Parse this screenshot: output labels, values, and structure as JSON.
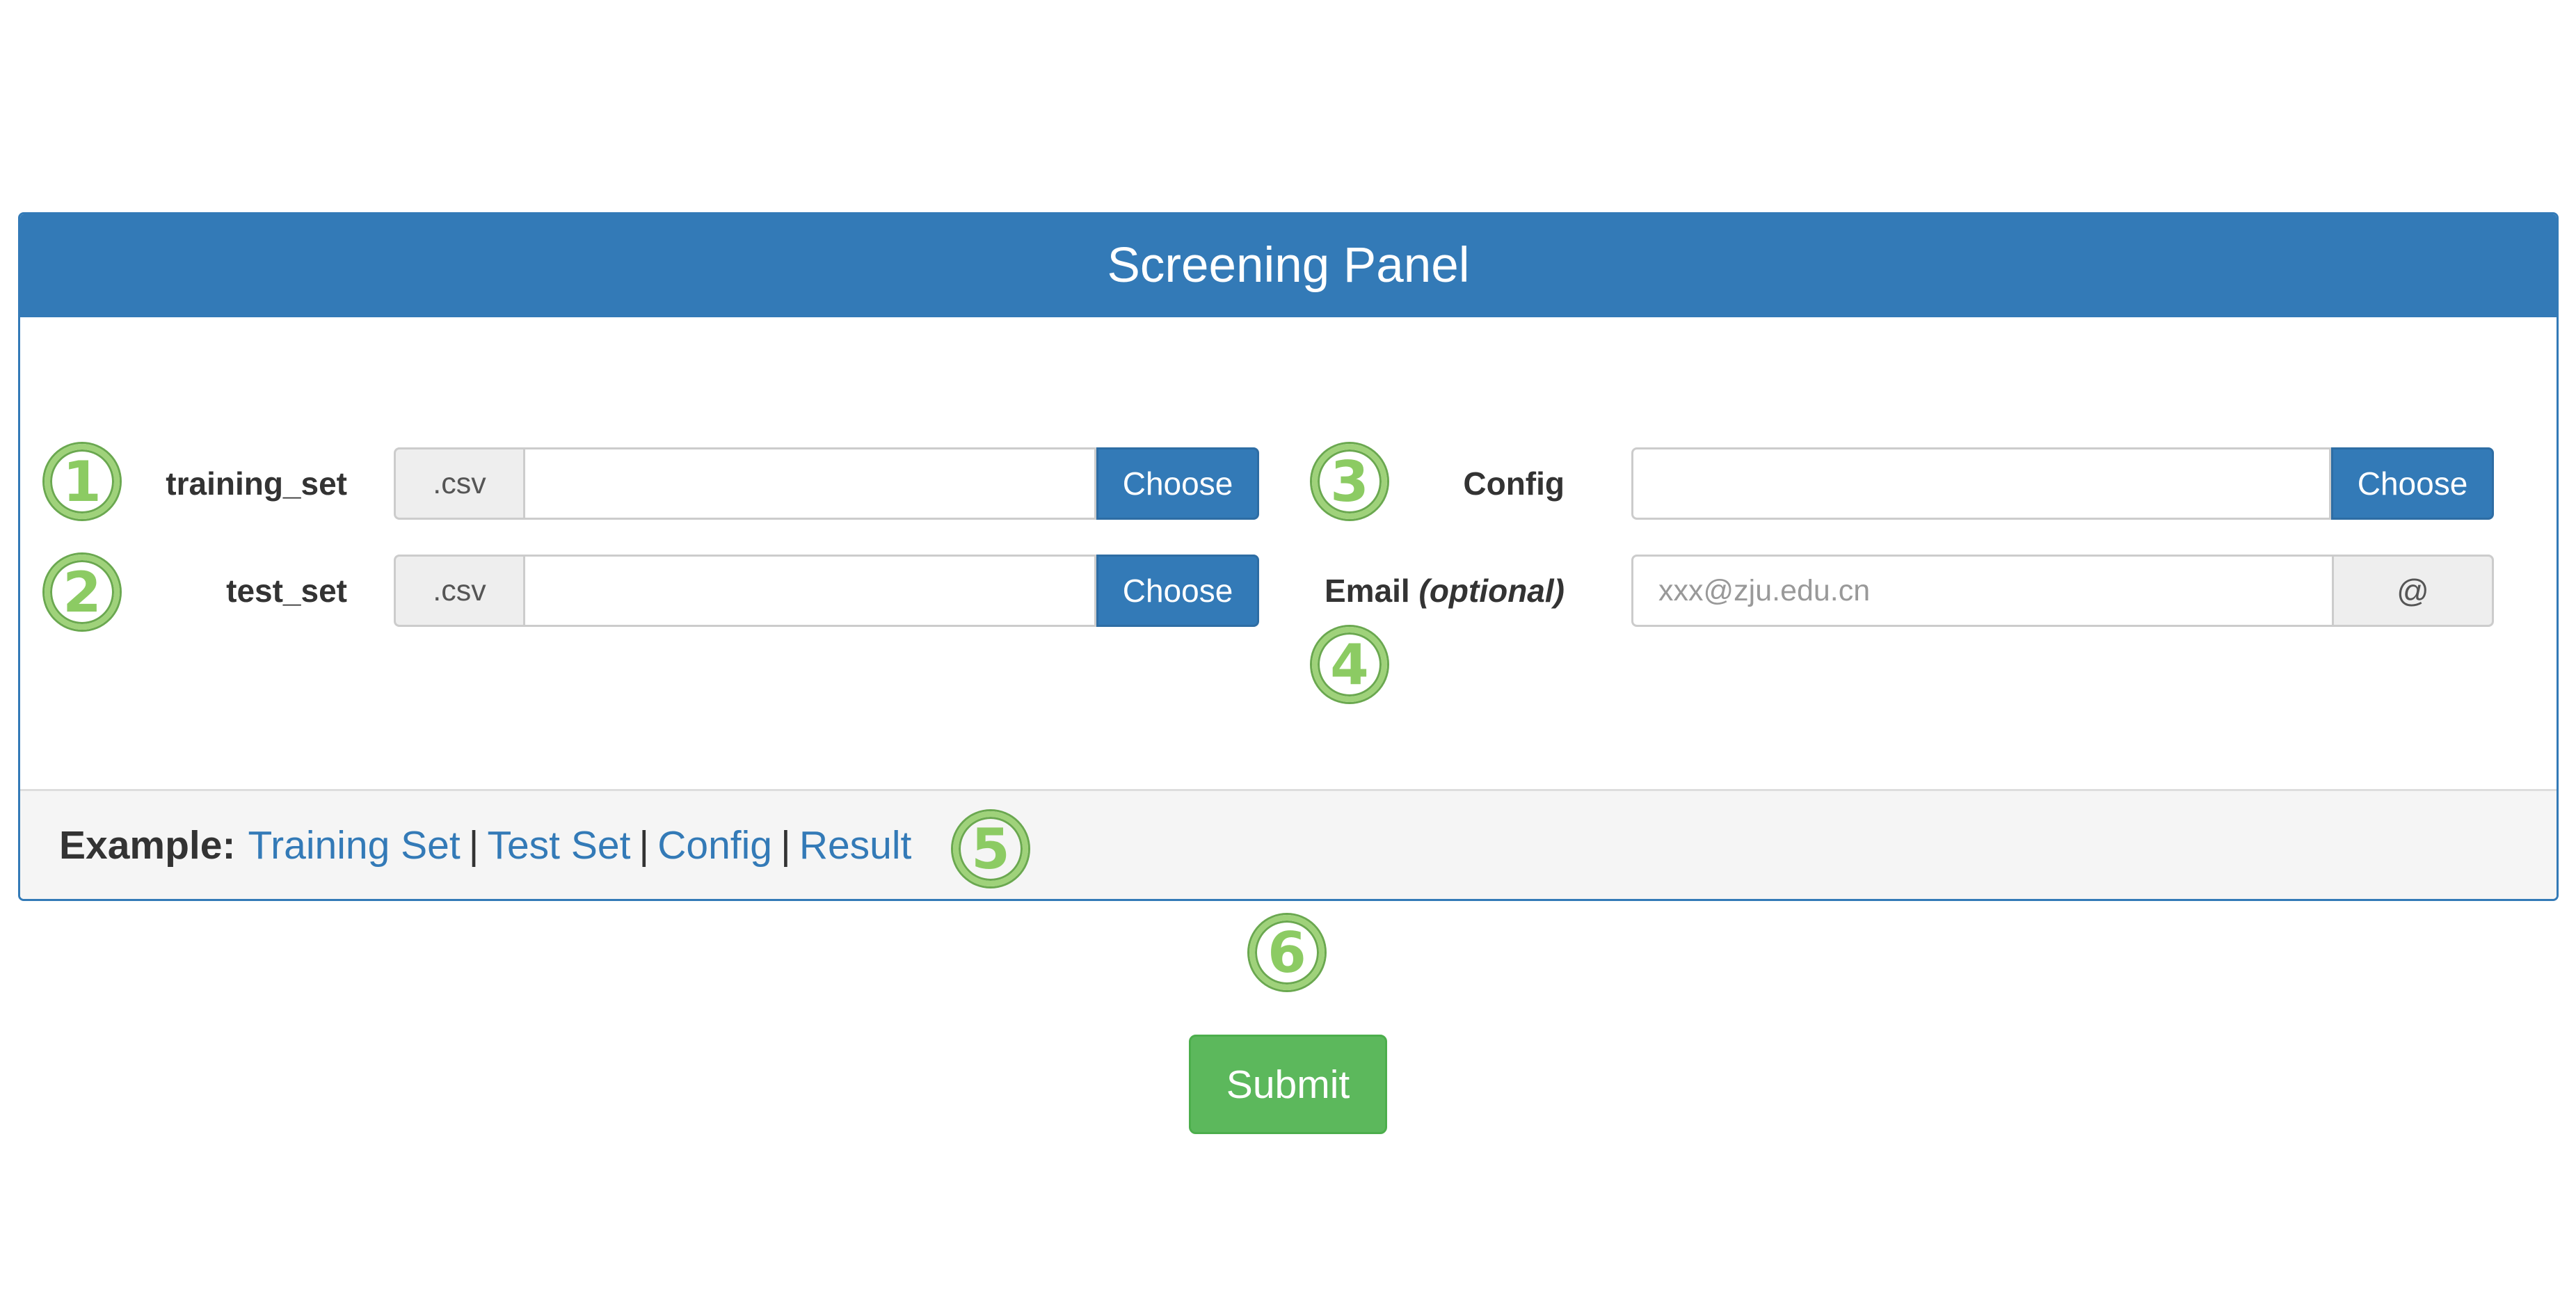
{
  "panel": {
    "title": "Screening Panel"
  },
  "form": {
    "training_set": {
      "label": "training_set",
      "addon": ".csv",
      "value": "",
      "button": "Choose"
    },
    "test_set": {
      "label": "test_set",
      "addon": ".csv",
      "value": "",
      "button": "Choose"
    },
    "config": {
      "label": "Config",
      "value": "",
      "button": "Choose"
    },
    "email": {
      "label": "Email",
      "label_suffix": "(optional)",
      "placeholder": "xxx@zju.edu.cn",
      "addon": "@"
    }
  },
  "footer": {
    "label": "Example:",
    "links": [
      "Training Set",
      "Test Set",
      "Config",
      "Result"
    ],
    "separator": "|"
  },
  "submit": {
    "label": "Submit"
  },
  "badges": [
    "1",
    "2",
    "3",
    "4",
    "5",
    "6"
  ],
  "colors": {
    "primary": "#337ab7",
    "success": "#5cb85c",
    "badge_green": "#8ccb63",
    "footer_bg": "#f5f5f5"
  }
}
